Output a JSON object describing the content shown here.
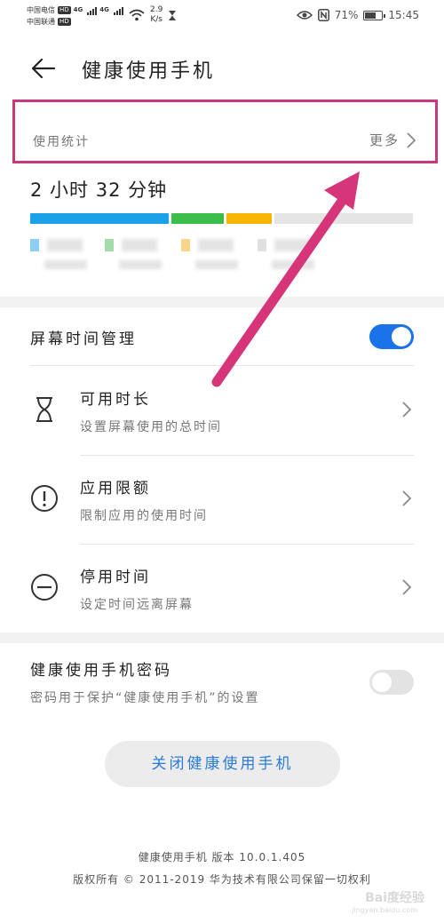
{
  "status_bar": {
    "carrier1": "中国电信",
    "carrier2": "中国联通",
    "hd": "HD",
    "net": "4G",
    "speed_value": "2.9",
    "speed_unit": "K/s",
    "battery_text": "71%",
    "battery_level": 0.71,
    "time": "15:45"
  },
  "header": {
    "title": "健康使用手机"
  },
  "usage": {
    "label": "使用统计",
    "more": "更多",
    "total_time": "2 小时 32 分钟",
    "segments": [
      {
        "color": "#1aa1e6",
        "fraction": 0.37
      },
      {
        "color": "#3cbf4a",
        "fraction": 0.14
      },
      {
        "color": "#f7b500",
        "fraction": 0.12
      },
      {
        "color": "#e5e5e5",
        "fraction": 0.37
      }
    ],
    "legend_colors": [
      "#8ccdf3",
      "#a3dca8",
      "#f7d58a",
      "#e0e0e0"
    ]
  },
  "screen_time": {
    "label": "屏幕时间管理",
    "enabled": true,
    "accent": "#1a73e8"
  },
  "items": [
    {
      "icon": "hourglass-icon",
      "title": "可用时长",
      "subtitle": "设置屏幕使用的总时间"
    },
    {
      "icon": "exclamation-circle-icon",
      "title": "应用限额",
      "subtitle": "限制应用的使用时间"
    },
    {
      "icon": "minus-circle-icon",
      "title": "停用时间",
      "subtitle": "设定时间远离屏幕"
    }
  ],
  "password": {
    "title": "健康使用手机密码",
    "subtitle": "密码用于保护“健康使用手机”的设置",
    "enabled": false
  },
  "close_button": "关闭健康使用手机",
  "footer": {
    "version": "健康使用手机 版本 10.0.1.405",
    "copyright": "版权所有 © 2011-2019 华为技术有限公司保留一切权利"
  },
  "watermark": {
    "logo": "Bai度经验",
    "url": "jingyan.baidu.com"
  },
  "annotation": {
    "highlight_color": "#c8387a",
    "arrow_color": "#d6357a"
  }
}
